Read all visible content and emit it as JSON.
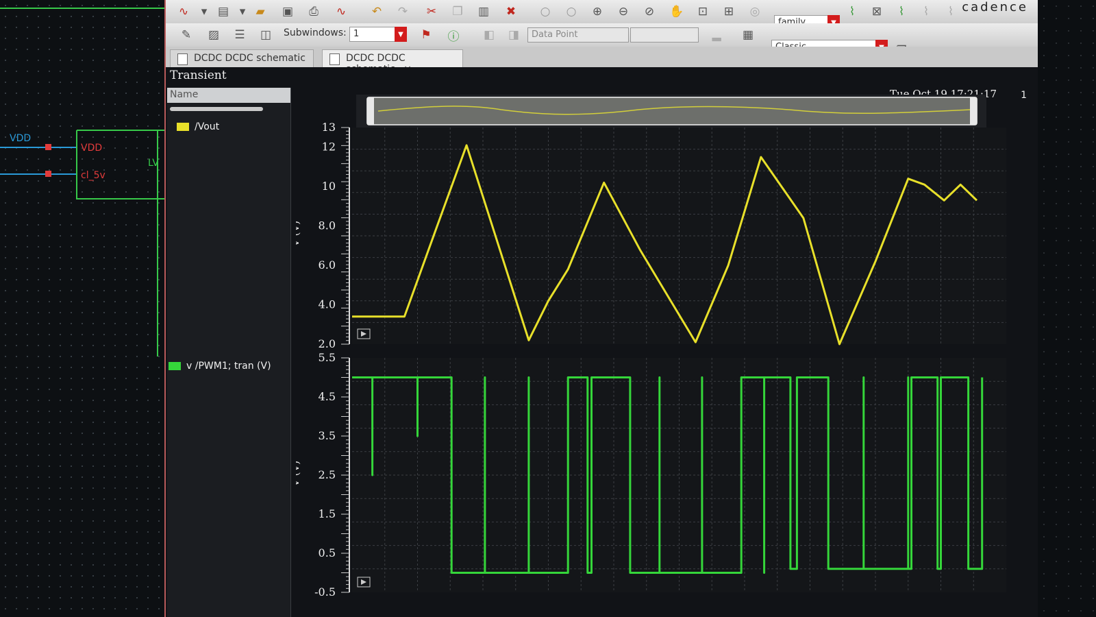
{
  "schematic": {
    "pins": [
      {
        "label": "VDD",
        "color": "#2a9ad8"
      },
      {
        "label": "VDD",
        "color": "#e23b3b"
      },
      {
        "label": "cl_5v",
        "color": "#e23b3b"
      }
    ],
    "edge_label": "LV"
  },
  "toolbar": {
    "brand": "cadence",
    "subwindows_label": "Subwindows:",
    "subwindows_value": "1",
    "data_point_placeholder": "Data Point",
    "family_value": "family",
    "classic_value": "Classic"
  },
  "tabs": [
    {
      "label": "DCDC DCDC schematic"
    },
    {
      "label": "DCDC DCDC schematic",
      "active": true
    }
  ],
  "panel": {
    "title": "Transient",
    "name_header": "Name",
    "timestamp": "Tue Oct 19 17:21:17",
    "subwindow_number": "1",
    "signals": [
      {
        "name": "/Vout",
        "color": "#e8e02a"
      },
      {
        "name": "v /PWM1; tran (V)",
        "color": "#35d63a"
      }
    ]
  },
  "chart_data": [
    {
      "type": "line",
      "title": "",
      "xlabel": "",
      "ylabel": "V (V)",
      "ylim": [
        2.0,
        13
      ],
      "yticks": [
        "2.0",
        "4.0",
        "6.0",
        "8.0",
        "10",
        "12",
        "13"
      ],
      "grid": true,
      "series": [
        {
          "name": "/Vout",
          "color": "#e8e02a",
          "x": [
            0,
            0.08,
            0.13,
            0.175,
            0.27,
            0.3,
            0.33,
            0.385,
            0.44,
            0.525,
            0.575,
            0.625,
            0.69,
            0.745,
            0.8,
            0.85,
            0.875,
            0.905,
            0.93,
            0.955
          ],
          "y": [
            3.4,
            3.4,
            8.0,
            12.1,
            2.2,
            4.2,
            5.8,
            10.2,
            6.8,
            2.1,
            6.0,
            11.5,
            8.4,
            2.0,
            6.2,
            10.4,
            10.1,
            9.3,
            10.1,
            9.3
          ]
        }
      ]
    },
    {
      "type": "line",
      "title": "",
      "xlabel": "",
      "ylabel": "V (V)",
      "ylim": [
        -0.5,
        5.5
      ],
      "yticks": [
        "-0.5",
        "0.5",
        "1.5",
        "2.5",
        "3.5",
        "4.5",
        "5.5"
      ],
      "grid": true,
      "series": [
        {
          "name": "v /PWM1; tran (V)",
          "color": "#35d63a",
          "x": [
            0,
            0.031,
            0.031,
            0.031,
            0.036,
            0.036,
            0.1,
            0.1,
            0.1,
            0.152,
            0.152,
            0.203,
            0.203,
            0.203,
            0.27,
            0.27,
            0.27,
            0.33,
            0.33,
            0.36,
            0.36,
            0.366,
            0.366,
            0.373,
            0.373,
            0.425,
            0.425,
            0.47,
            0.47,
            0.47,
            0.535,
            0.535,
            0.535,
            0.595,
            0.595,
            0.63,
            0.63,
            0.63,
            0.67,
            0.67,
            0.68,
            0.68,
            0.728,
            0.728,
            0.782,
            0.782,
            0.782,
            0.85,
            0.85,
            0.85,
            0.855,
            0.855,
            0.895,
            0.895,
            0.9,
            0.9,
            0.942,
            0.942,
            0.963,
            0.963
          ],
          "y": [
            5.0,
            5.0,
            2.5,
            5.0,
            5.0,
            5.0,
            5.0,
            3.5,
            5.0,
            5.0,
            0.0,
            0.0,
            5.0,
            0.0,
            0.0,
            5.0,
            0.0,
            0.0,
            5.0,
            5.0,
            0.0,
            0.0,
            5.0,
            5.0,
            5.0,
            5.0,
            0.0,
            0.0,
            5.0,
            0.0,
            0.0,
            5.0,
            0.0,
            0.0,
            5.0,
            5.0,
            0.0,
            5.0,
            5.0,
            0.1,
            0.1,
            5.0,
            5.0,
            0.1,
            0.1,
            5.0,
            0.1,
            0.1,
            5.0,
            0.1,
            0.1,
            5.0,
            5.0,
            0.1,
            0.1,
            5.0,
            5.0,
            0.1,
            0.1,
            5.0
          ]
        }
      ]
    }
  ]
}
